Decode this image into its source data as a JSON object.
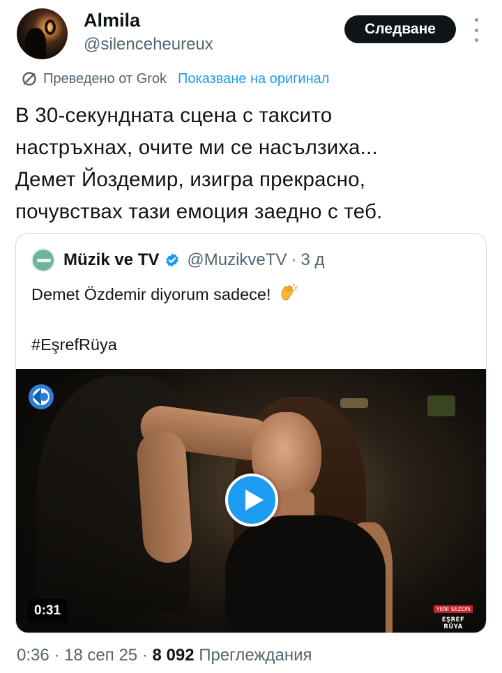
{
  "post": {
    "author_name": "Almila",
    "author_handle": "@silenceheureux",
    "follow_label": "Следване",
    "translated_label": "Преведено от Grok",
    "show_original_label": "Показване на оригинал",
    "text_lines": [
      "В 30-секундната сцена с таксито",
      "настръхнах, очите ми се насълзиха...",
      "Демет Йоздемир, изигра прекрасно,",
      "почувствах тази емоция заедно с теб."
    ]
  },
  "quote": {
    "author_name": "Müzik ve TV",
    "author_handle": "@MuzikveTV",
    "separator": "·",
    "time": "3 д",
    "text": "Demet Özdemir diyorum sadece!",
    "hashtag": "#EşrefRüya",
    "video": {
      "duration": "0:31",
      "badge_top": "YENİ SEZON",
      "badge_bottom": "EŞREF RÜYA"
    }
  },
  "footer": {
    "time": "0:36",
    "sep1": "·",
    "date": "18 сеп 25",
    "sep2": "·",
    "views_count": "8 092",
    "views_label": "Преглеждания"
  },
  "colors": {
    "accent": "#1d9bf0",
    "text": "#0f1419",
    "muted": "#536471",
    "follow_bg": "#0f1419"
  },
  "icons": {
    "translate": "translate-icon",
    "verified": "verified-badge-icon",
    "more": "more-options-icon",
    "play": "play-icon",
    "clap": "clapping-hands-emoji"
  }
}
